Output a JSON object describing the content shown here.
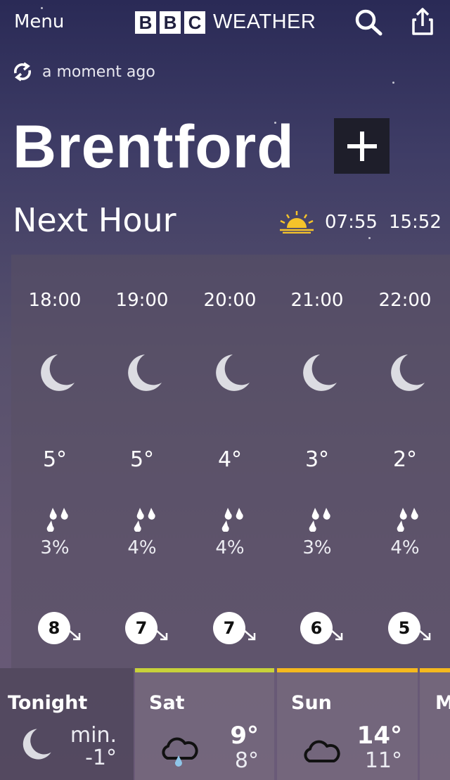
{
  "header": {
    "menu_label": "Menu",
    "logo_letters": [
      "B",
      "B",
      "C"
    ],
    "logo_word": "WEATHER"
  },
  "updated": "a moment ago",
  "location": "Brentford",
  "next_hour": {
    "title": "Next Hour",
    "sunrise": "07:55",
    "sunset": "15:52"
  },
  "hourly": [
    {
      "time": "18:00",
      "temp": "5°",
      "chance": "3%",
      "wind": "8"
    },
    {
      "time": "19:00",
      "temp": "5°",
      "chance": "4%",
      "wind": "7"
    },
    {
      "time": "20:00",
      "temp": "4°",
      "chance": "4%",
      "wind": "7"
    },
    {
      "time": "21:00",
      "temp": "3°",
      "chance": "3%",
      "wind": "6"
    },
    {
      "time": "22:00",
      "temp": "2°",
      "chance": "4%",
      "wind": "5"
    }
  ],
  "daily": {
    "tonight": {
      "name": "Tonight",
      "min_label": "min.",
      "min": "-1°"
    },
    "sat": {
      "name": "Sat",
      "high": "9°",
      "low": "8°"
    },
    "sun": {
      "name": "Sun",
      "high": "14°",
      "low": "11°"
    },
    "mon": {
      "name": "M"
    }
  },
  "icons": {
    "menu": "none",
    "search": "search-icon",
    "share": "share-icon",
    "refresh": "refresh-icon",
    "favourite": "plus-icon",
    "sun": "sunrise-icon",
    "hourly_weather": "moon-icon",
    "rain": "raindrops-icon",
    "wind": "wind-arrow-icon",
    "sat_weather": "cloud-rain-icon",
    "sun_weather": "cloud-icon"
  },
  "colors": {
    "sat_accent": "#c8d23a",
    "sun_accent": "#f5b91e",
    "sun_icon": "#f5c32a"
  }
}
